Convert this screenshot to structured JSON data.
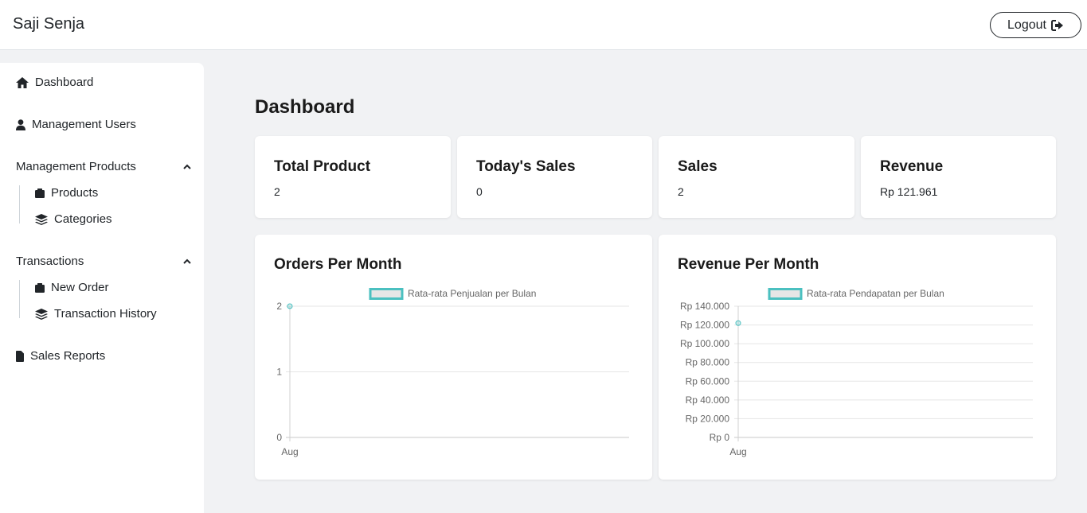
{
  "header": {
    "brand": "Saji Senja",
    "logout_label": "Logout"
  },
  "sidebar": {
    "dashboard": "Dashboard",
    "users": "Management Users",
    "products_group": "Management Products",
    "products": "Products",
    "categories": "Categories",
    "transactions_group": "Transactions",
    "new_order": "New Order",
    "transaction_history": "Transaction History",
    "sales_reports": "Sales Reports"
  },
  "main": {
    "title": "Dashboard",
    "stats": [
      {
        "title": "Total Product",
        "value": "2"
      },
      {
        "title": "Today's Sales",
        "value": "0"
      },
      {
        "title": "Sales",
        "value": "2"
      },
      {
        "title": "Revenue",
        "value": "Rp 121.961"
      }
    ]
  },
  "chart_data": [
    {
      "type": "line",
      "title": "Orders Per Month",
      "categories": [
        "Aug"
      ],
      "series": [
        {
          "name": "Rata-rata Penjualan per Bulan",
          "values": [
            2
          ]
        }
      ],
      "yticks": [
        "0",
        "1",
        "2"
      ],
      "ylim": [
        0,
        2
      ],
      "grid": true,
      "legend": "top",
      "color": "#4bc0c0"
    },
    {
      "type": "line",
      "title": "Revenue Per Month",
      "categories": [
        "Aug"
      ],
      "series": [
        {
          "name": "Rata-rata Pendapatan per Bulan",
          "values": [
            121961
          ]
        }
      ],
      "yticks": [
        "Rp 0",
        "Rp 20.000",
        "Rp 40.000",
        "Rp 60.000",
        "Rp 80.000",
        "Rp 100.000",
        "Rp 120.000",
        "Rp 140.000"
      ],
      "ylim": [
        0,
        140000
      ],
      "grid": true,
      "legend": "top",
      "color": "#4bc0c0"
    }
  ]
}
